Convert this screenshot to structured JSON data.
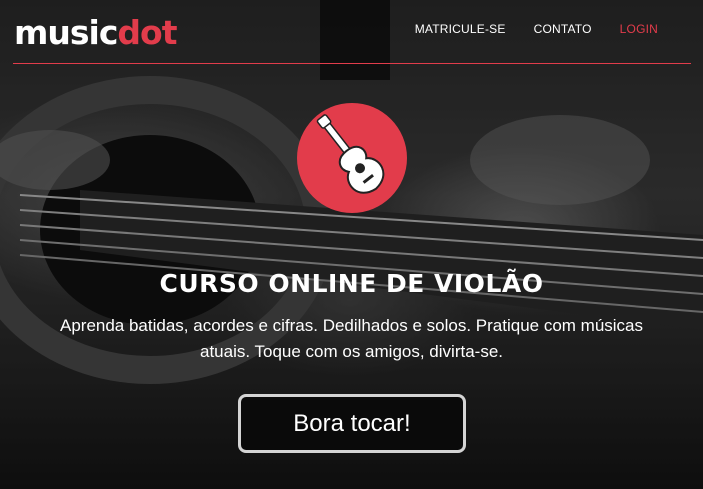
{
  "brand": {
    "logo_text_1": "music",
    "logo_text_2": "dot",
    "accent": "#e23c4b"
  },
  "nav": {
    "items": [
      {
        "label": "MATRICULE-SE",
        "active": false
      },
      {
        "label": "CONTATO",
        "active": false
      },
      {
        "label": "LOGIN",
        "active": true
      }
    ]
  },
  "hero": {
    "icon": "guitar-icon",
    "title": "CURSO ONLINE DE VIOLÃO",
    "subtitle_line1": "Aprenda batidas, acordes e cifras. Dedilhados e solos. Pratique com músicas",
    "subtitle_line2": "atuais. Toque com os amigos, divirta-se.",
    "cta_label": "Bora tocar!"
  }
}
